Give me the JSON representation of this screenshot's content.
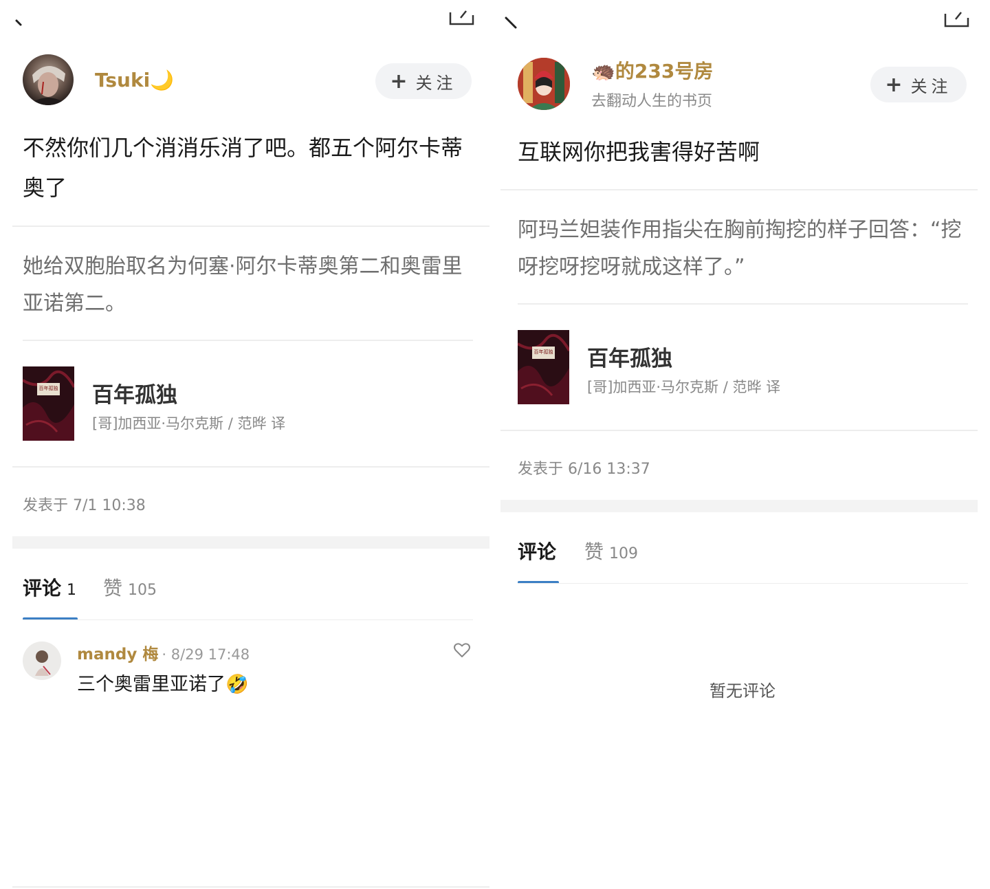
{
  "left": {
    "user": {
      "name": "Tsuki",
      "name_emoji": "🌙"
    },
    "follow_label": "关注",
    "follow_plus": "+",
    "post_text": "不然你们几个消消乐消了吧。都五个阿尔卡蒂奥了",
    "quote": "她给双胞胎取名为何塞·阿尔卡蒂奥第二和奥雷里亚诺第二。",
    "book": {
      "title": "百年孤独",
      "author": "[哥]加西亚·马尔克斯 / 范晔 译",
      "cover_text": "百年孤独"
    },
    "posted_at": "发表于 7/1 10:38",
    "tabs": {
      "comments_label": "评论",
      "comments_count": "1",
      "likes_label": "赞",
      "likes_count": "105"
    },
    "comment": {
      "name": "mandy 梅",
      "time": "· 8/29 17:48",
      "text": "三个奥雷里亚诺了",
      "emoji": "🤣"
    }
  },
  "right": {
    "user": {
      "name": "的233号房",
      "name_emoji": "🦔",
      "subtitle": "去翻动人生的书页"
    },
    "follow_label": "关注",
    "follow_plus": "+",
    "post_text": "互联网你把我害得好苦啊",
    "quote": "阿玛兰妲装作用指尖在胸前掏挖的样子回答：“挖呀挖呀挖呀就成这样了。”",
    "book": {
      "title": "百年孤独",
      "author": "[哥]加西亚·马尔克斯 / 范晔 译",
      "cover_text": "百年孤独"
    },
    "posted_at": "发表于 6/16 13:37",
    "tabs": {
      "comments_label": "评论",
      "likes_label": "赞",
      "likes_count": "109"
    },
    "empty_comments": "暂无评论"
  },
  "colors": {
    "username": "#b0893f",
    "tab_underline": "#3b7fc4",
    "book_cover": "#2a0d14"
  },
  "icons": [
    "back-arrow-icon",
    "share-icon",
    "heart-icon",
    "plus-icon"
  ]
}
